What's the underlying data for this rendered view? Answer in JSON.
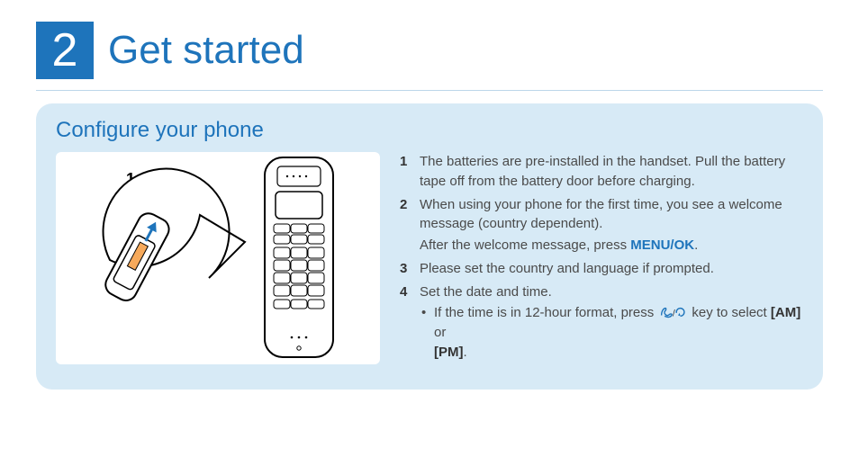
{
  "chapter": {
    "number": "2",
    "title": "Get started"
  },
  "section": {
    "title": "Configure your phone",
    "illustration_label": "1"
  },
  "steps": {
    "s1": "The batteries are pre-installed in the handset. Pull the battery tape off from the battery door before charging.",
    "s2_line1": "When using your phone for the first time, you see a welcome message (country dependent).",
    "s2_line2_pre": "After the welcome message, press ",
    "s2_menu_ok": "MENU/OK",
    "s2_line2_post": ".",
    "s3": "Please set the country and language if prompted.",
    "s4": "Set the date and time.",
    "s4_sub_pre": "If the time is in 12-hour format, press ",
    "s4_sub_mid": " key to select ",
    "s4_am": "[AM]",
    "s4_or": " or ",
    "s4_pm": "[PM]",
    "s4_sub_post": "."
  },
  "icons": {
    "key_icon_name": "phone-redial-key-icon"
  }
}
